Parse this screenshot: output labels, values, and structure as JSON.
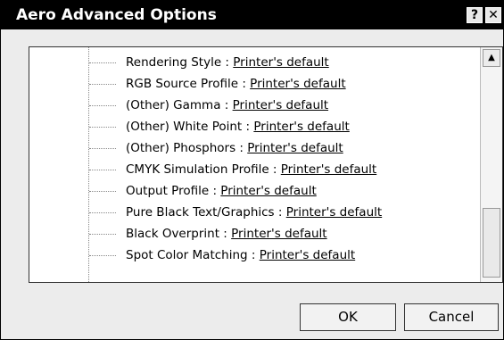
{
  "dialog": {
    "title": "Aero Advanced Options",
    "help_button": "?",
    "close_button": "✕"
  },
  "options": [
    {
      "label": "Rendering Style : ",
      "value": "Printer's default"
    },
    {
      "label": "RGB Source Profile : ",
      "value": "Printer's default"
    },
    {
      "label": "(Other) Gamma : ",
      "value": "Printer's default"
    },
    {
      "label": "(Other) White Point : ",
      "value": "Printer's default"
    },
    {
      "label": "(Other) Phosphors : ",
      "value": "Printer's default"
    },
    {
      "label": "CMYK Simulation Profile : ",
      "value": "Printer's default"
    },
    {
      "label": "Output Profile : ",
      "value": "Printer's default"
    },
    {
      "label": "Pure Black Text/Graphics : ",
      "value": "Printer's default"
    },
    {
      "label": "Black Overprint : ",
      "value": "Printer's default"
    },
    {
      "label": "Spot Color Matching : ",
      "value": "Printer's default"
    }
  ],
  "scrollbar": {
    "up_arrow": "▲"
  },
  "buttons": {
    "ok": "OK",
    "cancel": "Cancel"
  }
}
